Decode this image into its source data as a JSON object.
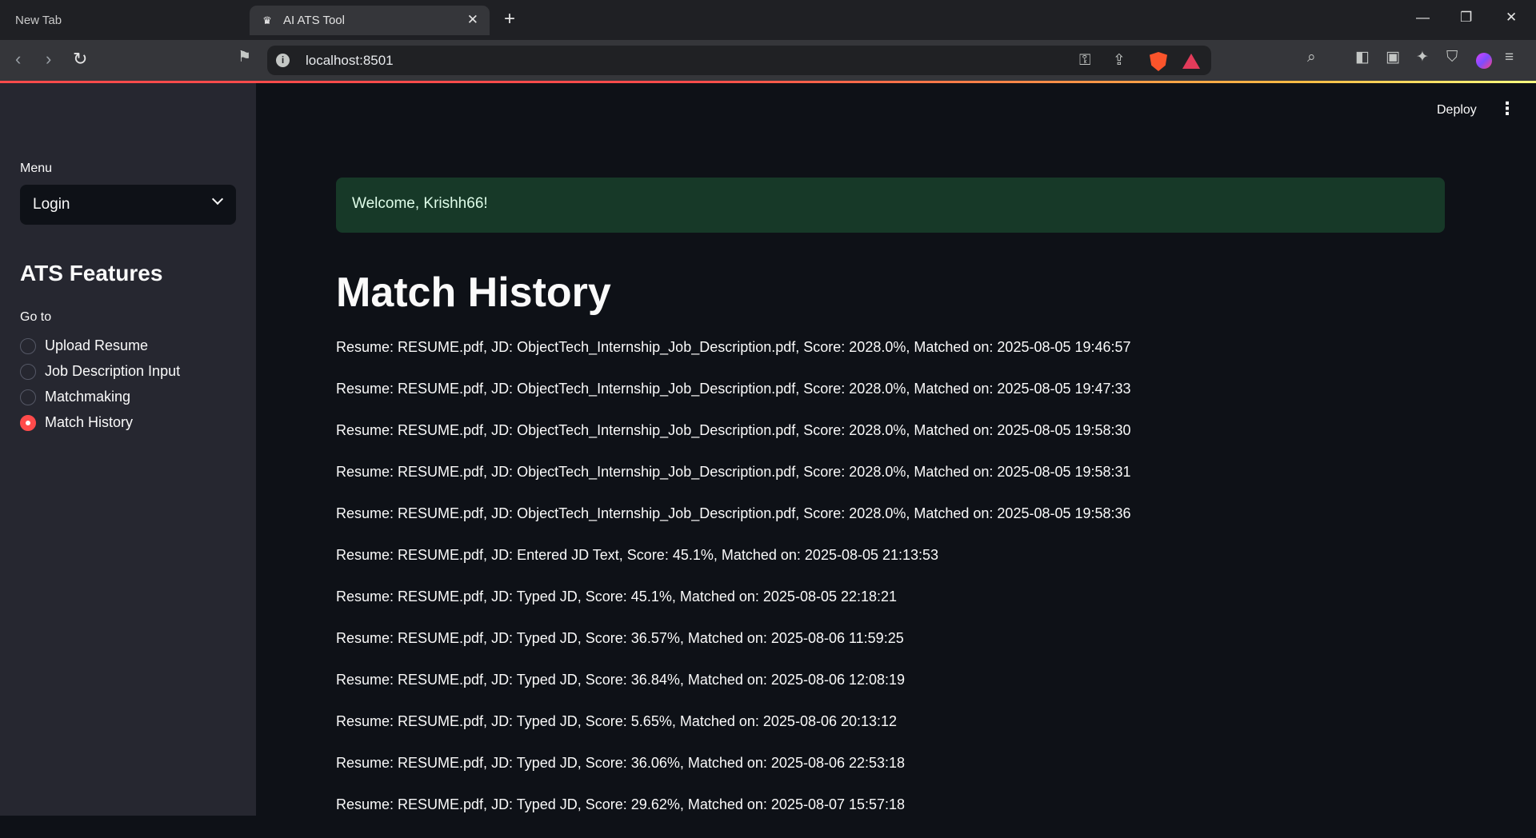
{
  "browser": {
    "tabs": [
      {
        "label": "New Tab"
      },
      {
        "label": "AI ATS Tool"
      }
    ],
    "url": "localhost:8501"
  },
  "sidebar": {
    "menu_label": "Menu",
    "menu_selected": "Login",
    "heading": "ATS Features",
    "goto_label": "Go to",
    "options": [
      {
        "label": "Upload Resume",
        "selected": false
      },
      {
        "label": "Job Description Input",
        "selected": false
      },
      {
        "label": "Matchmaking",
        "selected": false
      },
      {
        "label": "Match History",
        "selected": true
      }
    ]
  },
  "header": {
    "deploy_label": "Deploy"
  },
  "main": {
    "welcome": "Welcome, Krishh66!",
    "title": "Match History",
    "history": [
      "Resume: RESUME.pdf, JD: ObjectTech_Internship_Job_Description.pdf, Score: 2028.0%, Matched on: 2025-08-05 19:46:57",
      "Resume: RESUME.pdf, JD: ObjectTech_Internship_Job_Description.pdf, Score: 2028.0%, Matched on: 2025-08-05 19:47:33",
      "Resume: RESUME.pdf, JD: ObjectTech_Internship_Job_Description.pdf, Score: 2028.0%, Matched on: 2025-08-05 19:58:30",
      "Resume: RESUME.pdf, JD: ObjectTech_Internship_Job_Description.pdf, Score: 2028.0%, Matched on: 2025-08-05 19:58:31",
      "Resume: RESUME.pdf, JD: ObjectTech_Internship_Job_Description.pdf, Score: 2028.0%, Matched on: 2025-08-05 19:58:36",
      "Resume: RESUME.pdf, JD: Entered JD Text, Score: 45.1%, Matched on: 2025-08-05 21:13:53",
      "Resume: RESUME.pdf, JD: Typed JD, Score: 45.1%, Matched on: 2025-08-05 22:18:21",
      "Resume: RESUME.pdf, JD: Typed JD, Score: 36.57%, Matched on: 2025-08-06 11:59:25",
      "Resume: RESUME.pdf, JD: Typed JD, Score: 36.84%, Matched on: 2025-08-06 12:08:19",
      "Resume: RESUME.pdf, JD: Typed JD, Score: 5.65%, Matched on: 2025-08-06 20:13:12",
      "Resume: RESUME.pdf, JD: Typed JD, Score: 36.06%, Matched on: 2025-08-06 22:53:18",
      "Resume: RESUME.pdf, JD: Typed JD, Score: 29.62%, Matched on: 2025-08-07 15:57:18"
    ]
  },
  "colors": {
    "accent": "#ff4b4b",
    "success_bg": "#173928",
    "sidebar_bg": "#262730",
    "main_bg": "#0e1117"
  },
  "icons": [
    "back-icon",
    "forward-icon",
    "reload-icon",
    "bookmark-icon",
    "info-icon",
    "key-icon",
    "share-icon",
    "brave-shield-icon",
    "brave-rewards-icon",
    "search-tabs-icon",
    "sidebar-icon",
    "wallet-icon",
    "leo-icon",
    "vpn-icon",
    "profile-icon",
    "menu-icon",
    "close-icon",
    "plus-icon",
    "chevron-down-icon",
    "kebab-icon"
  ]
}
